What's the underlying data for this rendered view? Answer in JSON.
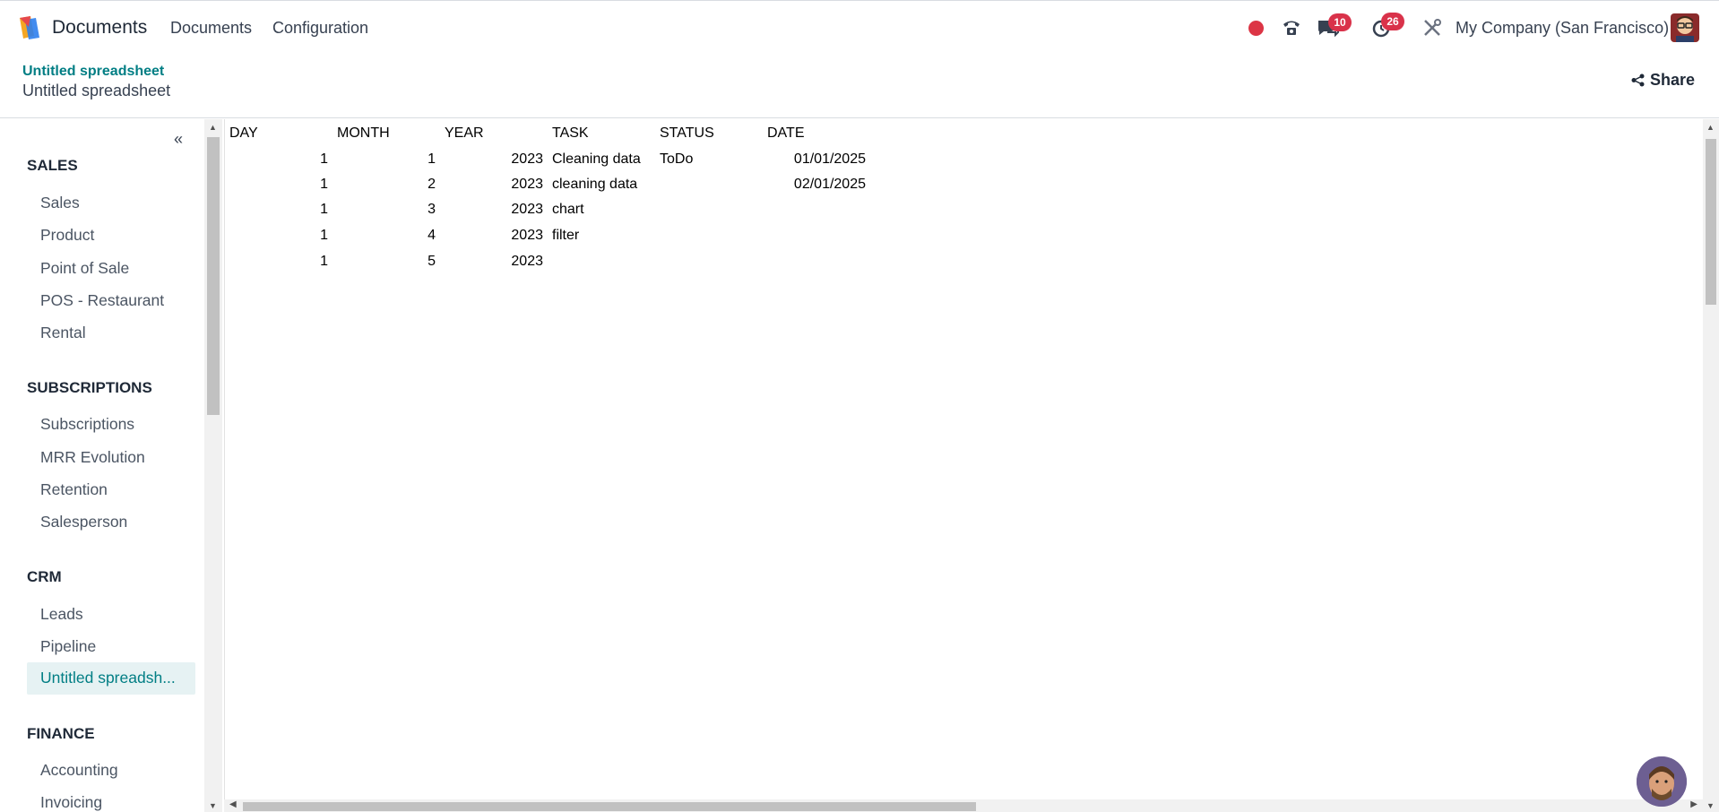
{
  "app": {
    "name": "Documents",
    "logo_icon": "odoo-documents-logo-icon"
  },
  "navbar": {
    "menu": [
      {
        "label": "Documents"
      },
      {
        "label": "Configuration"
      }
    ],
    "message_count": "10",
    "activity_count": "26",
    "company": "My Company (San Francisco)",
    "colors": {
      "badge": "#d9324a",
      "recording": "#dc3545",
      "accent": "#017e84"
    }
  },
  "breadcrumb": {
    "parent": "Untitled spreadsheet",
    "current": "Untitled spreadsheet"
  },
  "share": {
    "label": "Share"
  },
  "sidebar": {
    "sections": [
      {
        "title": "SALES",
        "items": [
          "Sales",
          "Product",
          "Point of Sale",
          "POS - Restaurant",
          "Rental"
        ]
      },
      {
        "title": "SUBSCRIPTIONS",
        "items": [
          "Subscriptions",
          "MRR Evolution",
          "Retention",
          "Salesperson"
        ]
      },
      {
        "title": "CRM",
        "items": [
          "Leads",
          "Pipeline",
          "Untitled spreadsh..."
        ]
      },
      {
        "title": "FINANCE",
        "items": [
          "Accounting",
          "Invoicing"
        ]
      }
    ],
    "active_item": "Untitled spreadsh..."
  },
  "sheet": {
    "headers": [
      "DAY",
      "MONTH",
      "YEAR",
      "TASK",
      "STATUS",
      "DATE"
    ],
    "rows": [
      [
        "1",
        "1",
        "2023",
        "Cleaning data",
        "ToDo",
        "01/01/2025"
      ],
      [
        "1",
        "2",
        "2023",
        "cleaning data",
        "",
        "02/01/2025"
      ],
      [
        "1",
        "3",
        "2023",
        "chart",
        "",
        ""
      ],
      [
        "1",
        "4",
        "2023",
        "filter",
        "",
        ""
      ],
      [
        "1",
        "5",
        "2023",
        "",
        "",
        ""
      ]
    ]
  }
}
